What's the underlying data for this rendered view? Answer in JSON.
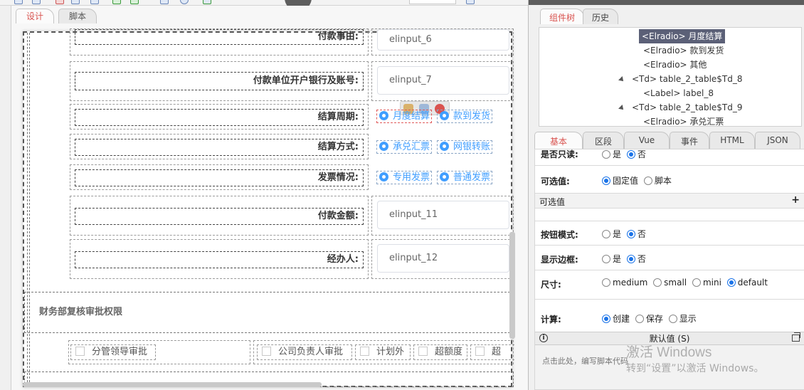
{
  "designer": {
    "tabs": [
      "设计",
      "脚本"
    ],
    "rows": [
      {
        "label": "付款事由:",
        "input": "elinput_6"
      },
      {
        "label": "付款单位开户银行及账号:",
        "input": "elinput_7"
      },
      {
        "label": "结算周期:",
        "radios": [
          "月度结算",
          "款到发货"
        ]
      },
      {
        "label": "结算方式:",
        "radios": [
          "承兑汇票",
          "网银转账"
        ]
      },
      {
        "label": "发票情况:",
        "radios": [
          "专用发票",
          "普通发票"
        ]
      },
      {
        "label": "付款金额:",
        "input": "elinput_11"
      },
      {
        "label": "经办人:",
        "input": "elinput_12"
      }
    ],
    "section_title": "财务部复核审批权限",
    "checkboxes": [
      "分管领导审批",
      "公司负责人审批",
      "计划外",
      "超额度",
      "超"
    ]
  },
  "right": {
    "top_tabs": [
      "组件树",
      "历史"
    ],
    "tree": [
      {
        "text": "<Elradio> 月度结算",
        "indent": 2,
        "selected": true
      },
      {
        "text": "<Elradio> 款到发货",
        "indent": 2
      },
      {
        "text": "<Elradio> 其他",
        "indent": 2
      },
      {
        "text": "<Td> table_2_table$Td_8",
        "indent": 1,
        "expand": true
      },
      {
        "text": "<Label> label_8",
        "indent": 2
      },
      {
        "text": "<Td> table_2_table$Td_9",
        "indent": 1,
        "expand": true
      },
      {
        "text": "<Elradio> 承兑汇票",
        "indent": 2
      }
    ],
    "prop_tabs": [
      "基本",
      "区段",
      "Vue",
      "事件",
      "HTML",
      "JSON"
    ],
    "props": {
      "readonly": {
        "label": "是否只读:",
        "options": [
          "是",
          "否"
        ],
        "selected": 1
      },
      "selectable": {
        "label": "可选值:",
        "options": [
          "固定值",
          "脚本"
        ],
        "selected": 0
      },
      "group_label": "可选值",
      "group_plus": "+",
      "button_mode": {
        "label": "按钮模式:",
        "options": [
          "是",
          "否"
        ],
        "selected": 1
      },
      "show_border": {
        "label": "显示边框:",
        "options": [
          "是",
          "否"
        ],
        "selected": 1
      },
      "size": {
        "label": "尺寸:",
        "options": [
          "medium",
          "small",
          "mini",
          "default"
        ],
        "selected": 3
      },
      "compute": {
        "label": "计算:",
        "options": [
          "创建",
          "保存",
          "显示"
        ],
        "selected": 0
      }
    },
    "default_panel": {
      "title": "默认值 (S)",
      "hint": "点击此处，编写脚本代码"
    }
  },
  "watermark": {
    "line1": "激活 Windows",
    "line2": "转到“设置”以激活 Windows。"
  }
}
